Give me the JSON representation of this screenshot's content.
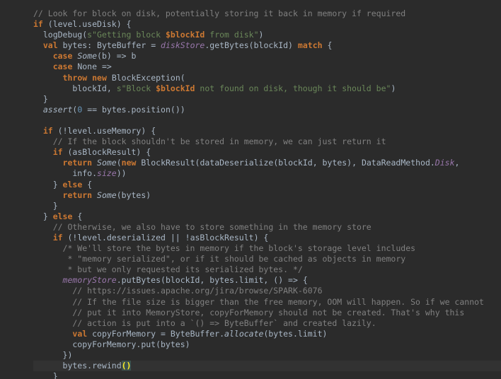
{
  "editor": {
    "lines": [
      [
        [
          "c",
          "// Look for block on disk, potentially storing it back in memory if required"
        ]
      ],
      [
        [
          "k",
          "if"
        ],
        [
          "n",
          " (level.useDisk) {"
        ]
      ],
      [
        [
          "n",
          "  logDebug("
        ],
        [
          "s",
          "s\"Getting block "
        ],
        [
          "v",
          "$blockId"
        ],
        [
          "s",
          " from disk\""
        ],
        [
          "n",
          ")"
        ]
      ],
      [
        [
          "n",
          "  "
        ],
        [
          "k",
          "val"
        ],
        [
          "n",
          " bytes: ByteBuffer = "
        ],
        [
          "f",
          "diskStore"
        ],
        [
          "n",
          ".getBytes(blockId) "
        ],
        [
          "k",
          "match"
        ],
        [
          "n",
          " {"
        ]
      ],
      [
        [
          "n",
          "    "
        ],
        [
          "k",
          "case"
        ],
        [
          "n",
          " "
        ],
        [
          "i",
          "Some"
        ],
        [
          "n",
          "(b) => b"
        ]
      ],
      [
        [
          "n",
          "    "
        ],
        [
          "k",
          "case"
        ],
        [
          "n",
          " None =>"
        ]
      ],
      [
        [
          "n",
          "      "
        ],
        [
          "k",
          "throw"
        ],
        [
          "n",
          " "
        ],
        [
          "k",
          "new"
        ],
        [
          "n",
          " BlockException("
        ]
      ],
      [
        [
          "n",
          "        blockId, "
        ],
        [
          "s",
          "s\"Block "
        ],
        [
          "v",
          "$blockId"
        ],
        [
          "s",
          " not found on disk, though it should be\""
        ],
        [
          "n",
          ")"
        ]
      ],
      [
        [
          "n",
          "  }"
        ]
      ],
      [
        [
          "n",
          "  "
        ],
        [
          "i",
          "assert"
        ],
        [
          "n",
          "("
        ],
        [
          "m",
          "0"
        ],
        [
          "n",
          " == bytes.position())"
        ]
      ],
      [
        [
          "n",
          ""
        ]
      ],
      [
        [
          "n",
          "  "
        ],
        [
          "k",
          "if"
        ],
        [
          "n",
          " (!level.useMemory) {"
        ]
      ],
      [
        [
          "c",
          "    // If the block shouldn't be stored in memory, we can just return it"
        ]
      ],
      [
        [
          "n",
          "    "
        ],
        [
          "k",
          "if"
        ],
        [
          "n",
          " (asBlockResult) {"
        ]
      ],
      [
        [
          "n",
          "      "
        ],
        [
          "k",
          "return"
        ],
        [
          "n",
          " "
        ],
        [
          "i",
          "Some"
        ],
        [
          "n",
          "("
        ],
        [
          "k",
          "new"
        ],
        [
          "n",
          " BlockResult(dataDeserialize(blockId, bytes), DataReadMethod."
        ],
        [
          "f",
          "Disk"
        ],
        [
          "n",
          ","
        ]
      ],
      [
        [
          "n",
          "        info."
        ],
        [
          "f",
          "size"
        ],
        [
          "n",
          "))"
        ]
      ],
      [
        [
          "n",
          "    } "
        ],
        [
          "k",
          "else"
        ],
        [
          "n",
          " {"
        ]
      ],
      [
        [
          "n",
          "      "
        ],
        [
          "k",
          "return"
        ],
        [
          "n",
          " "
        ],
        [
          "i",
          "Some"
        ],
        [
          "n",
          "(bytes)"
        ]
      ],
      [
        [
          "n",
          "    }"
        ]
      ],
      [
        [
          "n",
          "  } "
        ],
        [
          "k",
          "else"
        ],
        [
          "n",
          " {"
        ]
      ],
      [
        [
          "c",
          "    // Otherwise, we also have to store something in the memory store"
        ]
      ],
      [
        [
          "n",
          "    "
        ],
        [
          "k",
          "if"
        ],
        [
          "n",
          " (!level.deserialized || !asBlockResult) {"
        ]
      ],
      [
        [
          "c",
          "      /* We'll store the bytes in memory if the block's storage level includes"
        ]
      ],
      [
        [
          "c",
          "       * \"memory serialized\", or if it should be cached as objects in memory"
        ]
      ],
      [
        [
          "c",
          "       * but we only requested its serialized bytes. */"
        ]
      ],
      [
        [
          "n",
          "      "
        ],
        [
          "f",
          "memoryStore"
        ],
        [
          "n",
          ".putBytes(blockId, bytes.limit, () => {"
        ]
      ],
      [
        [
          "c",
          "        // https://issues.apache.org/jira/browse/SPARK-6076"
        ]
      ],
      [
        [
          "c",
          "        // If the file size is bigger than the free memory, OOM will happen. So if we cannot"
        ]
      ],
      [
        [
          "c",
          "        // put it into MemoryStore, copyForMemory should not be created. That's why this"
        ]
      ],
      [
        [
          "c",
          "        // action is put into a `() => ByteBuffer` and created lazily."
        ]
      ],
      [
        [
          "n",
          "        "
        ],
        [
          "k",
          "val"
        ],
        [
          "n",
          " copyForMemory = ByteBuffer."
        ],
        [
          "i",
          "allocate"
        ],
        [
          "n",
          "(bytes.limit)"
        ]
      ],
      [
        [
          "n",
          "        copyForMemory.put(bytes)"
        ]
      ],
      [
        [
          "n",
          "      })"
        ]
      ],
      [
        [
          "n",
          "      bytes.rewind"
        ],
        [
          "b",
          "()"
        ]
      ],
      [
        [
          "n",
          "    }"
        ]
      ]
    ]
  }
}
